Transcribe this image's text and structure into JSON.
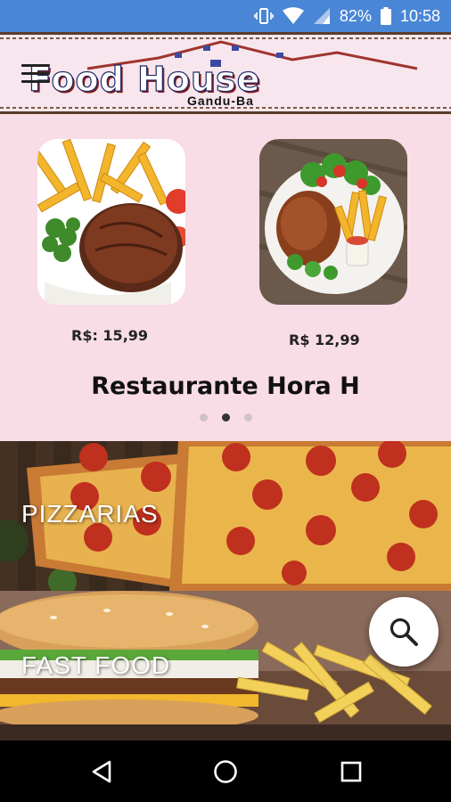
{
  "status_bar": {
    "battery": "82%",
    "time": "10:58"
  },
  "header": {
    "logo_title": "Food House",
    "logo_subtitle": "Gandu-Ba"
  },
  "slider": {
    "items": [
      {
        "price": "R$: 15,99"
      },
      {
        "price": "R$ 12,99"
      }
    ],
    "title": "Restaurante Hora H",
    "active_dot": 1
  },
  "categories": [
    {
      "label": "PIZZARIAS"
    },
    {
      "label": "FAST FOOD"
    }
  ],
  "colors": {
    "status_bar": "#4a86d6",
    "slider_bg": "#f8dce6",
    "header_bg": "#f7e6ee"
  }
}
